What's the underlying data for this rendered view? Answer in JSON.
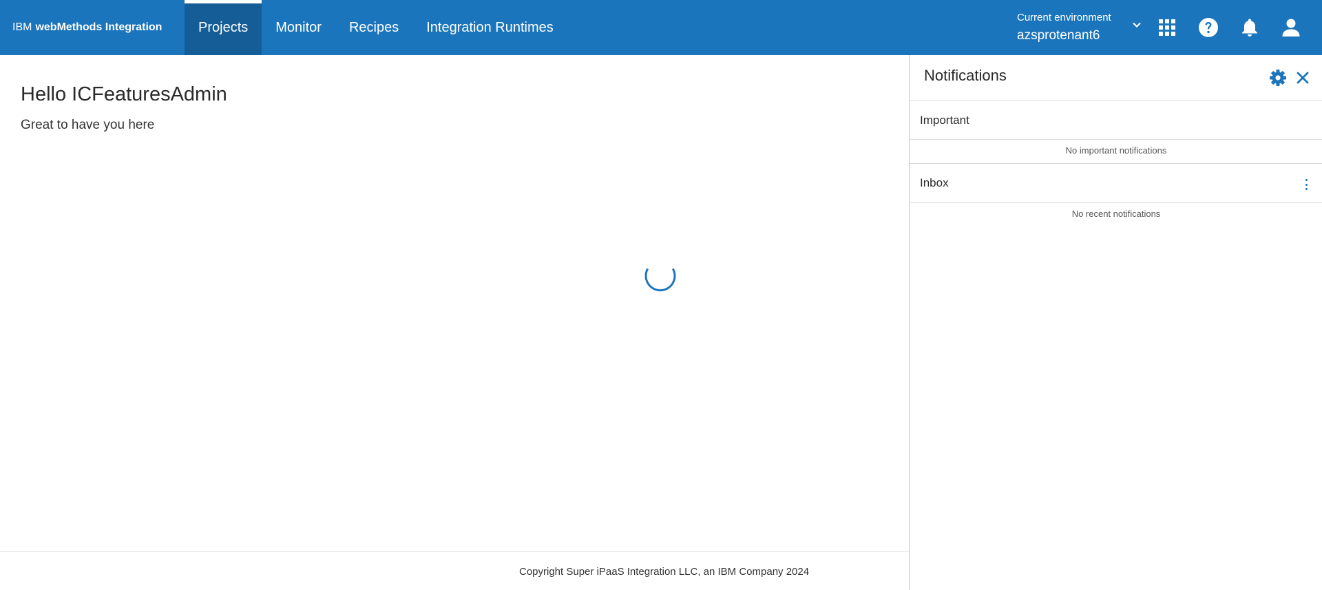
{
  "header": {
    "brand_prefix": "IBM",
    "brand_product": "webMethods Integration",
    "nav": [
      {
        "label": "Projects",
        "active": true
      },
      {
        "label": "Monitor",
        "active": false
      },
      {
        "label": "Recipes",
        "active": false
      },
      {
        "label": "Integration Runtimes",
        "active": false
      }
    ],
    "environment": {
      "label": "Current environment",
      "value": "azsprotenant6"
    },
    "icons": [
      "chevron-down-icon",
      "app-switcher-icon",
      "help-icon",
      "bell-icon",
      "user-icon"
    ]
  },
  "main": {
    "greeting": "Hello ICFeaturesAdmin",
    "subgreeting": "Great to have you here",
    "loading": true,
    "footer": "Copyright Super iPaaS Integration LLC, an IBM Company 2024"
  },
  "notifications": {
    "title": "Notifications",
    "important": {
      "heading": "Important",
      "empty": "No important notifications"
    },
    "inbox": {
      "heading": "Inbox",
      "empty": "No recent notifications"
    }
  },
  "colors": {
    "header_bg": "#1b75bc",
    "active_tab_bg": "#155d96",
    "accent": "#1b75bc"
  }
}
